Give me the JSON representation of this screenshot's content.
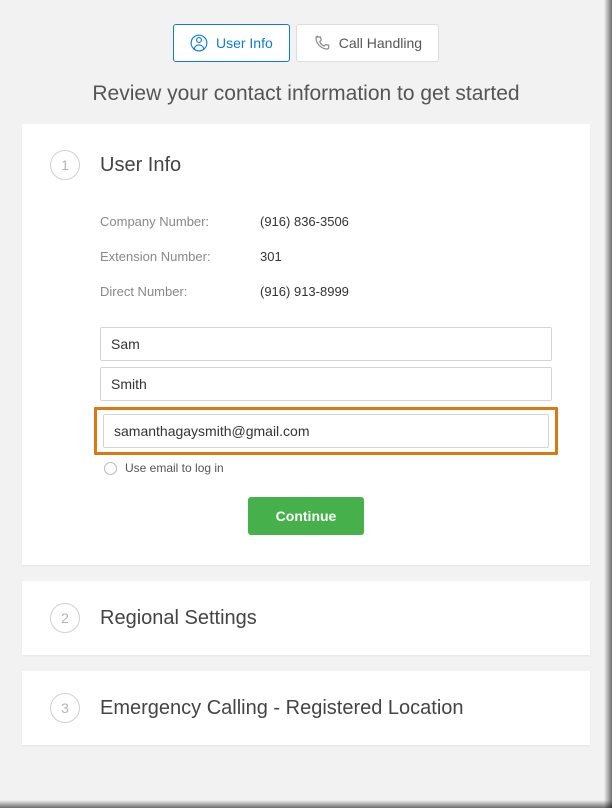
{
  "tabs": {
    "user_info": "User Info",
    "call_handling": "Call Handling"
  },
  "heading": "Review your contact information to get started",
  "steps": {
    "one": {
      "num": "1",
      "title": "User Info"
    },
    "two": {
      "num": "2",
      "title": "Regional Settings"
    },
    "three": {
      "num": "3",
      "title": "Emergency Calling - Registered Location"
    }
  },
  "info": {
    "company_label": "Company Number:",
    "company_value": "(916) 836-3506",
    "extension_label": "Extension Number:",
    "extension_value": "301",
    "direct_label": "Direct Number:",
    "direct_value": "(916) 913-8999"
  },
  "form": {
    "first_name": "Sam",
    "last_name": "Smith",
    "email": "samanthagaysmith@gmail.com",
    "use_email_label": "Use email to log in"
  },
  "buttons": {
    "continue": "Continue"
  }
}
